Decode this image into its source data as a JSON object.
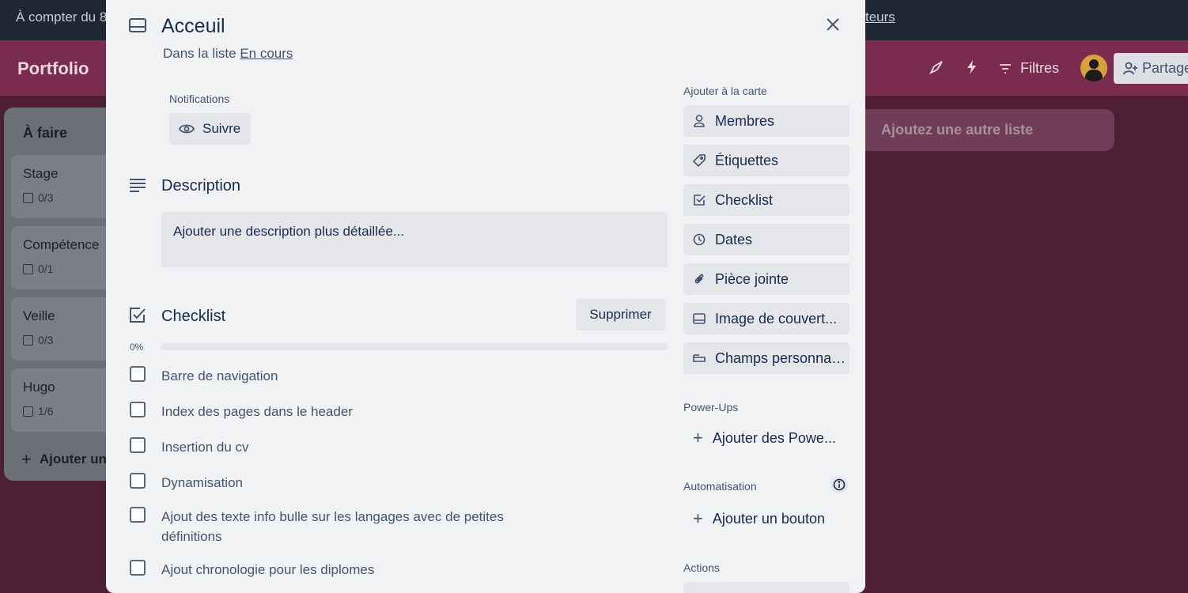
{
  "banner": {
    "left_text": "À compter du 8",
    "right_text": "teurs"
  },
  "board": {
    "title": "Portfolio",
    "filters_label": "Filtres",
    "share_label": "Partage",
    "add_list_label": "Ajoutez une autre liste"
  },
  "list": {
    "title": "À faire",
    "cards": [
      {
        "title": "Stage",
        "badge": "0/3"
      },
      {
        "title": "Compétence",
        "badge": "0/1"
      },
      {
        "title": "Veille",
        "badge": "0/3"
      },
      {
        "title": "Hugo",
        "badge": "1/6"
      }
    ],
    "add_card_label": "Ajouter un"
  },
  "modal": {
    "title": "Acceuil",
    "list_prefix": "Dans la liste ",
    "list_name": "En cours",
    "notifications_label": "Notifications",
    "follow_label": "Suivre",
    "description_title": "Description",
    "description_placeholder": "Ajouter une description plus détaillée...",
    "checklist_title": "Checklist",
    "delete_label": "Supprimer",
    "progress_text": "0%",
    "progress_fraction": 0,
    "items": [
      "Barre de navigation",
      "Index des pages dans le header",
      "Insertion du cv",
      "Dynamisation",
      "Ajout des texte info bulle sur les langages avec de petites définitions",
      "Ajout chronologie pour les diplomes"
    ]
  },
  "sidebar": {
    "add_to_card_label": "Ajouter à la carte",
    "buttons": [
      {
        "label": "Membres",
        "icon": "person-icon"
      },
      {
        "label": "Étiquettes",
        "icon": "tag-icon"
      },
      {
        "label": "Checklist",
        "icon": "checkbox-icon"
      },
      {
        "label": "Dates",
        "icon": "clock-icon"
      },
      {
        "label": "Pièce jointe",
        "icon": "paperclip-icon"
      },
      {
        "label": "Image de couvert...",
        "icon": "card-cover-icon"
      },
      {
        "label": "Champs personnali...",
        "icon": "custom-fields-icon"
      }
    ],
    "powerups_label": "Power-Ups",
    "add_powerups_label": "Ajouter des Powe...",
    "automation_label": "Automatisation",
    "add_button_label": "Ajouter un bouton",
    "actions_label": "Actions"
  },
  "colors": {
    "banner_bg": "#1e2733",
    "board_header_bg": "#7a2c4f",
    "board_bg": "#4e1e33",
    "modal_bg": "#f1f2f4",
    "button_bg": "#e4e6ea",
    "text_primary": "#172b4d",
    "text_secondary": "#44546f"
  }
}
